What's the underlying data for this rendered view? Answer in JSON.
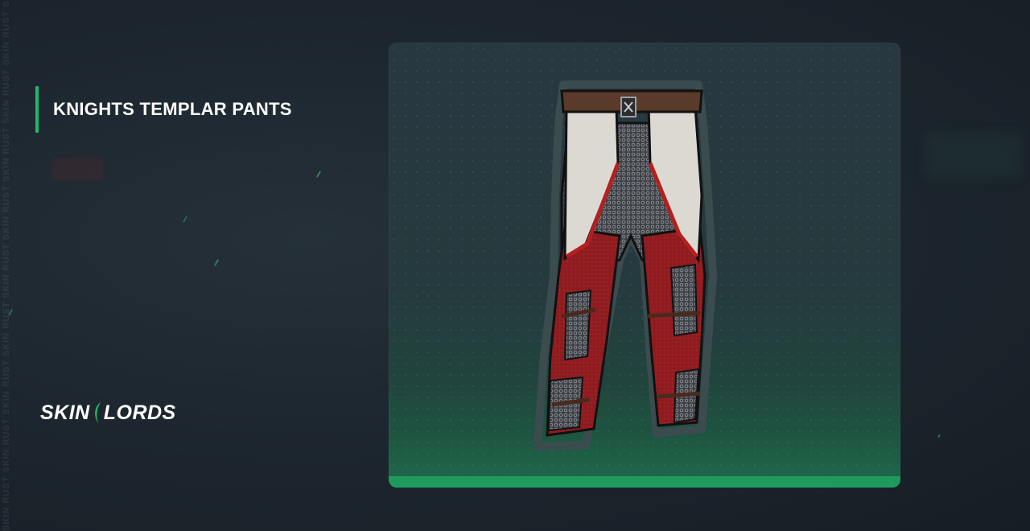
{
  "page": {
    "watermark": "SKIN RUST SKIN RUST SKIN RUST SKIN RUST SKIN RUST SKIN RUST SKIN RUST SKIN RUST SKIN RUST SKIN RUST"
  },
  "item": {
    "title": "KNIGHTS TEMPLAR PANTS",
    "image_icon": "knights-templar-pants-image"
  },
  "brand": {
    "left_text": "SKIN",
    "right_text": "LORDS",
    "accent_color": "#1fb86b"
  },
  "colors": {
    "accent": "#1fb86b",
    "rarity_bar": "#1e9a5c"
  }
}
